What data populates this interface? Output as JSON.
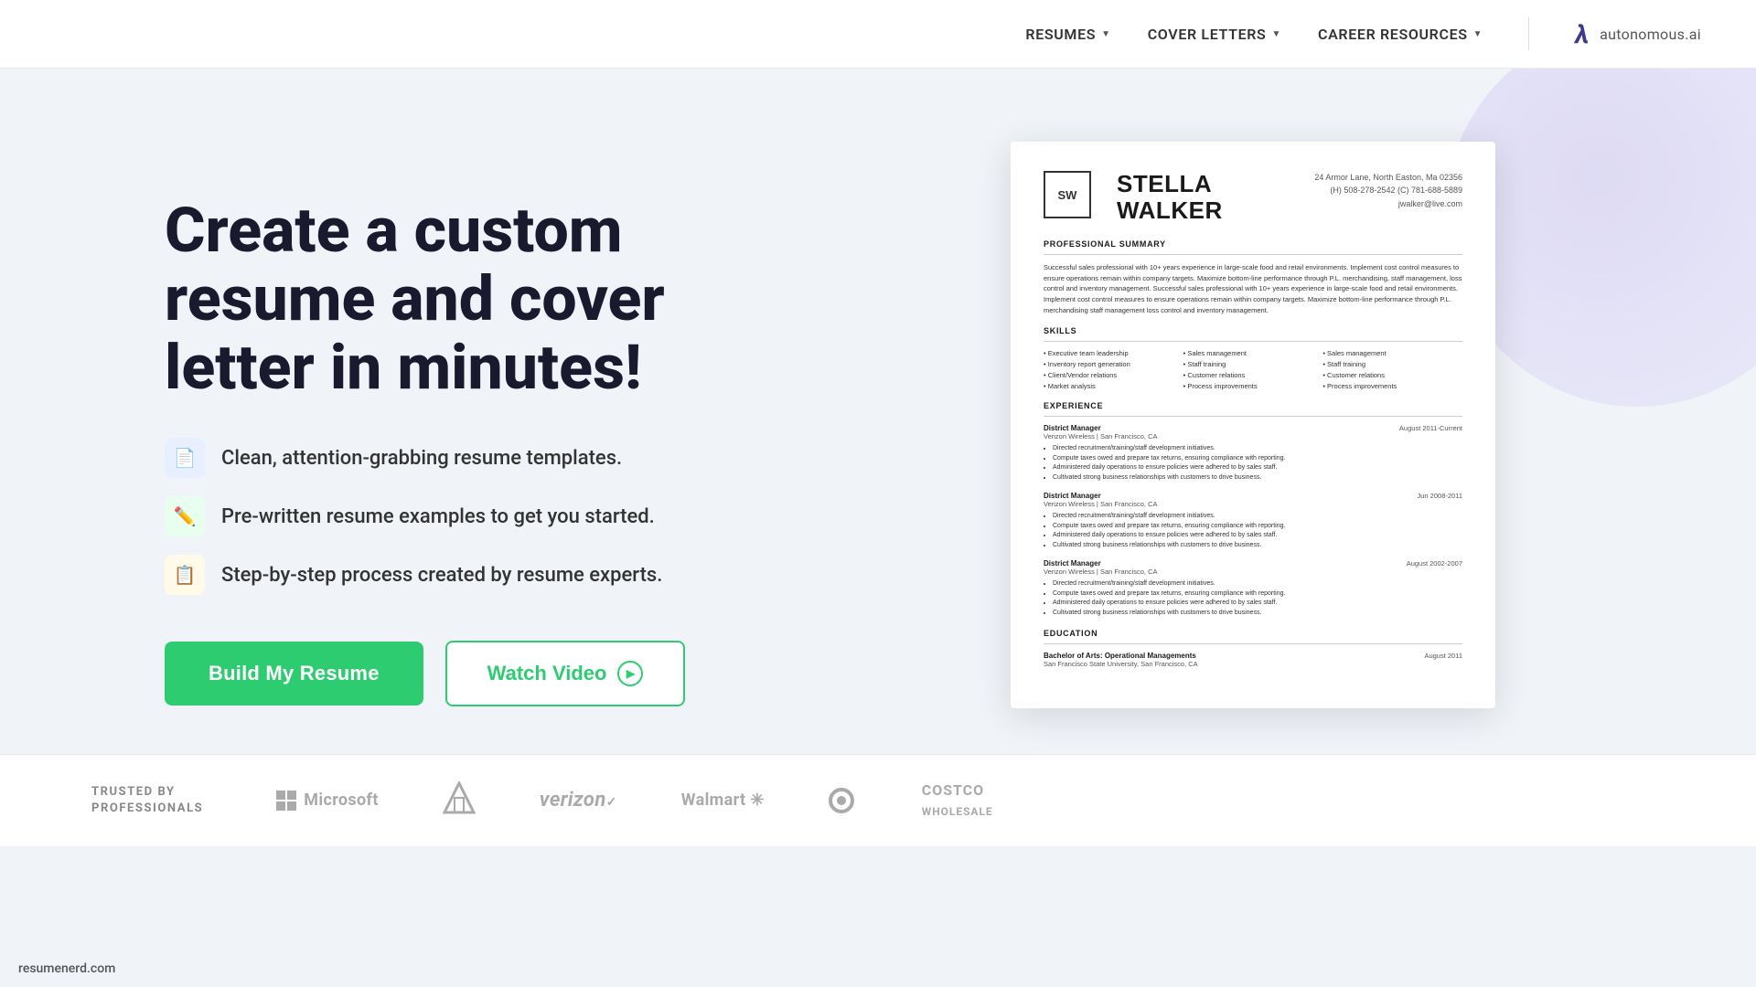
{
  "header": {
    "nav": [
      {
        "id": "resumes",
        "label": "RESUMES"
      },
      {
        "id": "cover-letters",
        "label": "COVER LETTERS"
      },
      {
        "id": "career-resources",
        "label": "CAREER RESOURCES"
      }
    ],
    "brand_logo": "λ",
    "brand_name": "autonomous.ai"
  },
  "hero": {
    "title": "Create a custom resume and cover letter in minutes!",
    "features": [
      {
        "id": "templates",
        "icon": "📄",
        "icon_type": "blue",
        "text": "Clean, attention-grabbing resume templates."
      },
      {
        "id": "examples",
        "icon": "✏️",
        "icon_type": "green",
        "text": "Pre-written resume examples to get you started."
      },
      {
        "id": "process",
        "icon": "📋",
        "icon_type": "yellow",
        "text": "Step-by-step process created by resume experts."
      }
    ],
    "cta_primary": "Build My Resume",
    "cta_secondary": "Watch Video"
  },
  "resume_preview": {
    "logo_initials": "SW",
    "name": "STELLA\nWALKER",
    "contact": "24 Armor Lane, North Easton, Ma 02356\n(H) 508-278-2542 (C) 781-688-5889\njwalker@live.com",
    "sections": {
      "summary_title": "PROFESSIONAL SUMMARY",
      "summary_text": "Successful sales professional with 10+ years experience in large-scale food and retail environments. Implement cost control measures to ensure operations remain within company targets. Maximize bottom-line performance through P.L. merchandising, staff management, loss control and inventory management. Successful sales professional with 10+ years experience in large-scale food and retail environments. Implement cost control measures to ensure operations remain within company targets. Maximize bottom-line performance through P.L. merchandising staff management loss control and inventory management.",
      "skills_title": "SKILLS",
      "skills": [
        "Executive team leadership",
        "Sales management",
        "Sales management",
        "Inventory report generation",
        "Staff training",
        "Staff training",
        "Client/Vendor relations",
        "Customer relations",
        "Customer relations",
        "Market analysis",
        "Process improvements",
        "Process improvements"
      ],
      "experience_title": "EXPERIENCE",
      "jobs": [
        {
          "title": "District Manager",
          "company": "Verizon Wireless | San Francisco, CA",
          "date": "August 2011-Current",
          "bullets": [
            "Directed recruitment/training/staff development initiatives.",
            "Compute taxes owed and prepare tax returns, ensuring compliance with reporting.",
            "Administered daily operations to ensure policies were adhered to by sales staff.",
            "Cultivated strong business relationships with customers to drive business."
          ]
        },
        {
          "title": "District Manager",
          "company": "Verizon Wireless | San Francisco, CA",
          "date": "Jun 2008-2011",
          "bullets": [
            "Directed recruitment/training/staff development initiatives.",
            "Compute taxes owed and prepare tax returns, ensuring compliance with reporting.",
            "Administered daily operations to ensure policies were adhered to by sales staff.",
            "Cultivated strong business relationships with customers to drive business."
          ]
        },
        {
          "title": "District Manager",
          "company": "Verizon Wireless | San Francisco, CA",
          "date": "August 2002-2007",
          "bullets": [
            "Directed recruitment/training/staff development initiatives.",
            "Compute taxes owed and prepare tax returns, ensuring compliance with reporting.",
            "Administered daily operations to ensure policies were adhered to by sales staff.",
            "Cultivated strong business relationships with customers to drive business."
          ]
        }
      ],
      "education_title": "EDUCATION",
      "education": {
        "degree": "Bachelor of Arts: Operational Managements",
        "school": "San Francisco State University, San Francisco, CA",
        "date": "August 2011"
      }
    }
  },
  "footer": {
    "trusted_label": "TRUSTED BY\nPROFESSIONALS",
    "logos": [
      {
        "id": "microsoft",
        "label": "Microsoft",
        "type": "microsoft"
      },
      {
        "id": "homedepot",
        "label": "The Home Depot",
        "type": "homedepot"
      },
      {
        "id": "verizon",
        "label": "verizon",
        "type": "text"
      },
      {
        "id": "walmart",
        "label": "Walmart",
        "type": "walmart"
      },
      {
        "id": "target",
        "label": "Target",
        "type": "target"
      },
      {
        "id": "costco",
        "label": "COSTCO\nWHOLESALE",
        "type": "text"
      }
    ]
  },
  "watermark": "resumenerd.com"
}
